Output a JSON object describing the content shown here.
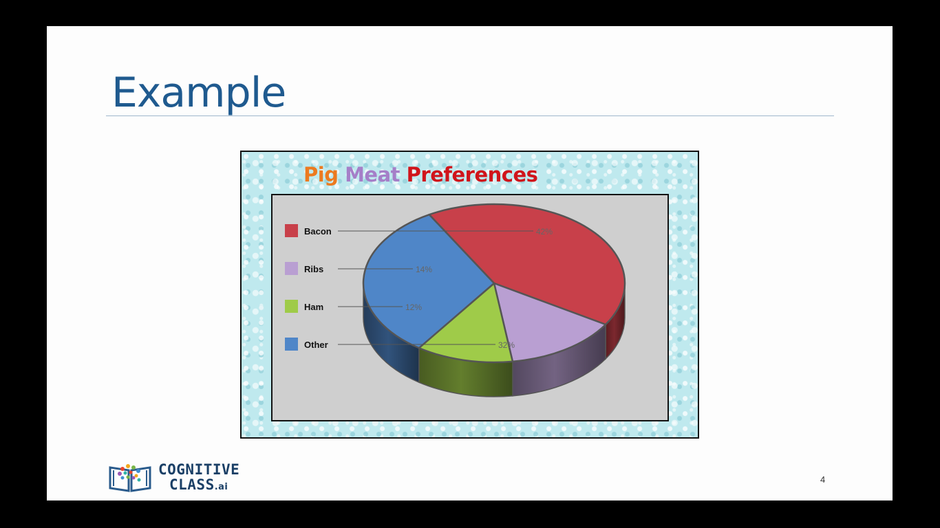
{
  "slide": {
    "title": "Example",
    "page_number": "4"
  },
  "logo": {
    "line1": "COGNITIVE",
    "line2": "CLASS",
    "suffix": ".ai"
  },
  "colors": {
    "title_blue": "#1f5a8f",
    "bacon": "#c8404a",
    "ribs": "#b99fd2",
    "ham": "#9fcb49",
    "other": "#4f86c8",
    "title_word1": "#ec7a1f",
    "title_word2": "#a57fc8",
    "title_word3": "#d0141b"
  },
  "chart_data": {
    "type": "pie",
    "style": "3d",
    "title_parts": [
      "Pig",
      "Meat",
      "Preferences"
    ],
    "legend_position": "left",
    "slices": [
      {
        "label": "Bacon",
        "value": 42,
        "display": "42%",
        "color": "#c8404a"
      },
      {
        "label": "Ribs",
        "value": 14,
        "display": "14%",
        "color": "#b99fd2"
      },
      {
        "label": "Ham",
        "value": 12,
        "display": "12%",
        "color": "#9fcb49"
      },
      {
        "label": "Other",
        "value": 32,
        "display": "32%",
        "color": "#4f86c8"
      }
    ]
  }
}
